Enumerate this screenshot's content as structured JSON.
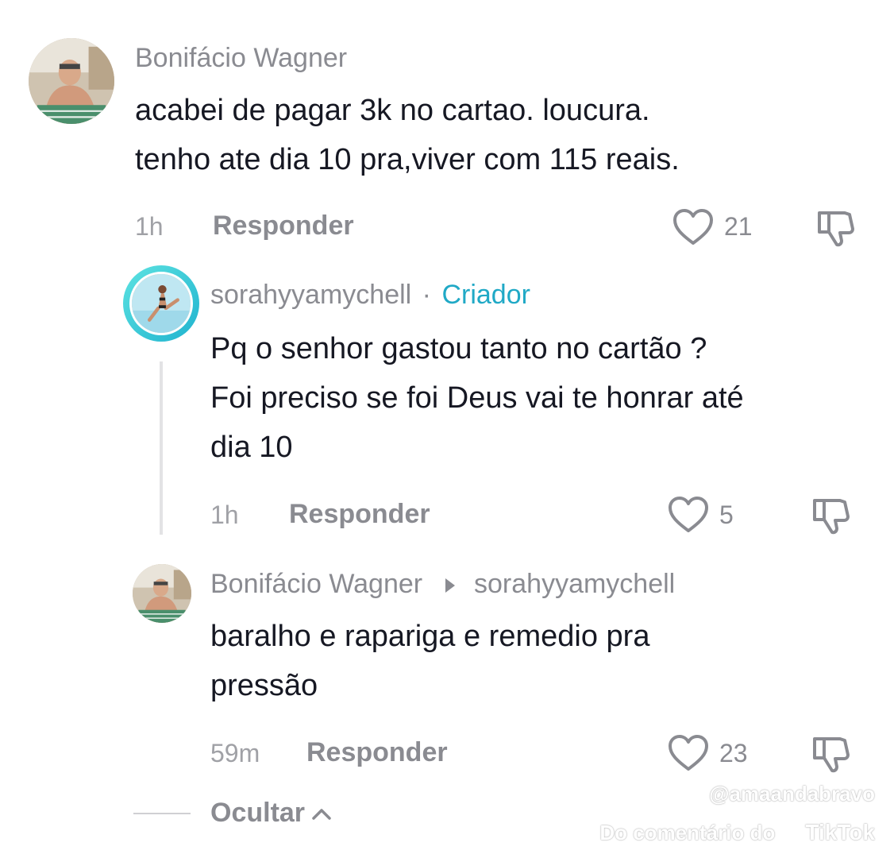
{
  "comments": [
    {
      "username": "Bonifácio Wagner",
      "lines": [
        "acabei de pagar 3k no cartao. loucura.",
        "tenho ate dia 10 pra,viver com 115 reais."
      ],
      "time": "1h",
      "reply_label": "Responder",
      "likes": "21"
    },
    {
      "username": "sorahyyamychell",
      "separator": "·",
      "badge": "Criador",
      "lines": [
        "Pq o senhor gastou tanto no cartão ?",
        "Foi preciso se foi Deus vai te honrar até",
        "dia 10"
      ],
      "time": "1h",
      "reply_label": "Responder",
      "likes": "5"
    },
    {
      "username": "Bonifácio Wagner",
      "reply_to": "sorahyyamychell",
      "lines": [
        "baralho e rapariga e remedio pra",
        "pressão"
      ],
      "time": "59m",
      "reply_label": "Responder",
      "likes": "23"
    }
  ],
  "hide_replies_label": "Ocultar",
  "watermark": {
    "handle": "@amaandabravo",
    "source": "Do comentário do",
    "brand": "TikTok"
  },
  "icons": {
    "like": "heart-outline-icon",
    "dislike": "thumbs-down-icon",
    "reply_arrow": "triangle-right-icon",
    "collapse": "chevron-up-icon"
  },
  "colors": {
    "creator_badge": "#20a9c6",
    "text": "#161823",
    "muted": "#8a8b91"
  }
}
